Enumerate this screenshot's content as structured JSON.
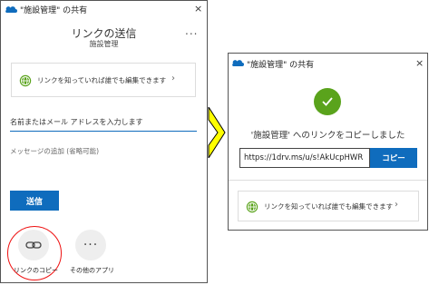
{
  "left_dialog": {
    "window_title": "\"施設管理\" の共有",
    "header_title": "リンクの送信",
    "header_subtitle": "施設管理",
    "more_glyph": "...",
    "close_glyph": "×",
    "permission_text": "リンクを知っていれば誰でも編集できます",
    "recipient_placeholder": "名前またはメール アドレスを入力します",
    "message_placeholder": "メッセージの追加 (省略可能)",
    "send_label": "送信",
    "apps": [
      {
        "label": "リンクのコピー",
        "icon": "link-icon"
      },
      {
        "label": "その他のアプリ",
        "icon": "more-apps-icon"
      }
    ]
  },
  "right_dialog": {
    "window_title": "\"施設管理\" の共有",
    "close_glyph": "×",
    "copied_message": "'施設管理' へのリンクをコピーしました",
    "link_url": "https://1drv.ms/u/s!AkUcpHWR",
    "copy_label": "コピー",
    "permission_text": "リンクを知っていれば誰でも編集できます"
  },
  "colors": {
    "accent": "#0f6cbd",
    "success": "#5aa31c",
    "highlight_ring": "#ee1111",
    "arrow_fill": "#ffff00"
  }
}
